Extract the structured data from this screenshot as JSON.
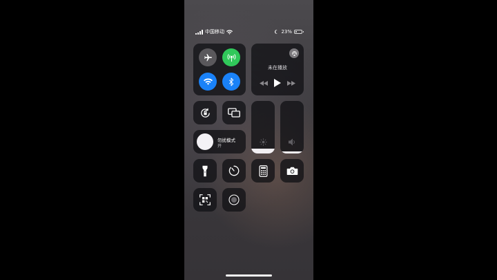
{
  "status_bar": {
    "carrier": "中国移动",
    "battery_text": "23%",
    "battery_level": 0.23
  },
  "connectivity": {
    "airplane": {
      "icon": "airplane-icon",
      "active": false
    },
    "cellular": {
      "icon": "cellular-antenna-icon",
      "active": true,
      "color": "#30c85a"
    },
    "wifi": {
      "icon": "wifi-icon",
      "active": true,
      "color": "#1a82f8"
    },
    "bluetooth": {
      "icon": "bluetooth-icon",
      "active": true,
      "color": "#1a82f8"
    }
  },
  "media": {
    "status_text": "未在播放",
    "airplay_icon": "airplay-icon",
    "controls": [
      "rewind-icon",
      "play-icon",
      "fast-forward-icon"
    ]
  },
  "toggles": {
    "orientation_lock_icon": "orientation-lock-icon",
    "screen_mirroring_icon": "screen-mirroring-icon"
  },
  "dnd": {
    "title": "勿扰模式",
    "state": "开",
    "icon": "moon-icon"
  },
  "brightness": {
    "icon": "sun-icon",
    "level": 0.09
  },
  "volume": {
    "icon": "speaker-icon",
    "level": 0.04
  },
  "shortcuts": [
    "flashlight-icon",
    "timer-icon",
    "calculator-icon",
    "camera-icon",
    "qr-scanner-icon",
    "screen-record-icon"
  ]
}
